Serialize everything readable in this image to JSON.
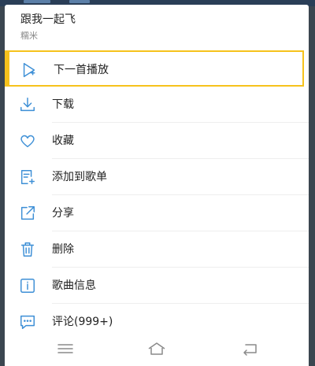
{
  "song": {
    "title": "跟我一起飞",
    "artist": "糯米"
  },
  "menu": {
    "items": [
      {
        "label": "下一首播放",
        "icon": "play-next-icon"
      },
      {
        "label": "下载",
        "icon": "download-icon"
      },
      {
        "label": "收藏",
        "icon": "heart-icon"
      },
      {
        "label": "添加到歌单",
        "icon": "add-to-playlist-icon"
      },
      {
        "label": "分享",
        "icon": "share-icon"
      },
      {
        "label": "删除",
        "icon": "trash-icon"
      },
      {
        "label": "歌曲信息",
        "icon": "info-icon"
      },
      {
        "label": "评论(999+)",
        "icon": "comment-icon"
      }
    ]
  },
  "colors": {
    "accent_icon": "#3d8fd6",
    "highlight": "#f6c21c",
    "text": "#222222",
    "subtext": "#8a8a8a"
  },
  "nav": {
    "icons": [
      "menu-icon",
      "home-icon",
      "back-icon"
    ]
  }
}
